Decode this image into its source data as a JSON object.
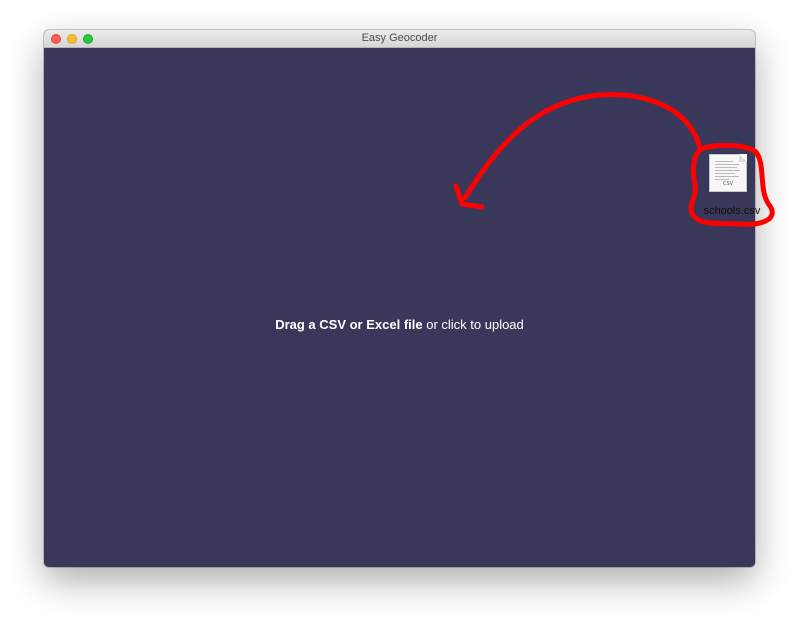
{
  "window": {
    "title": "Easy Geocoder"
  },
  "dropzone": {
    "bold_text": "Drag a CSV or Excel file",
    "normal_text": " or click to upload"
  },
  "dragged_file": {
    "name": "schools.csv",
    "type_tag": "CSV",
    "icon": "csv-file-icon"
  },
  "annotation": {
    "color": "#ff0000",
    "icon": "curved-arrow-icon"
  },
  "colors": {
    "content_background": "#3a385a",
    "close": "#fe5f57",
    "minimize": "#febc2e",
    "maximize": "#28c840"
  }
}
